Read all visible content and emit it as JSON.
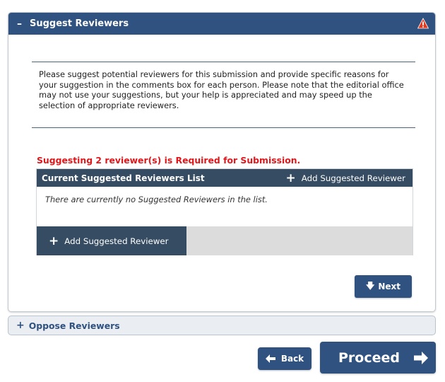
{
  "suggest_panel": {
    "toggle_symbol": "–",
    "title": "Suggest Reviewers",
    "warning_icon": "warning-triangle-icon",
    "header_color": "#2f5280",
    "instructions": "Please suggest potential reviewers for this submission and provide specific reasons for your suggestion in the comments box for each person. Please note that the editorial office may not use your suggestions, but your help is appreciated and may speed up the selection of appropriate reviewers.",
    "required_message": "Suggesting 2 reviewer(s) is Required for Submission.",
    "required_color": "#e0171b",
    "list": {
      "title": "Current Suggested Reviewers List",
      "header_add_label": "Add Suggested Reviewer",
      "empty_message": "There are currently no Suggested Reviewers in the list.",
      "footer_add_label": "Add Suggested Reviewer"
    },
    "next_label": "Next"
  },
  "oppose_panel": {
    "toggle_symbol": "+",
    "title": "Oppose Reviewers"
  },
  "navigation": {
    "back_label": "Back",
    "proceed_label": "Proceed"
  }
}
